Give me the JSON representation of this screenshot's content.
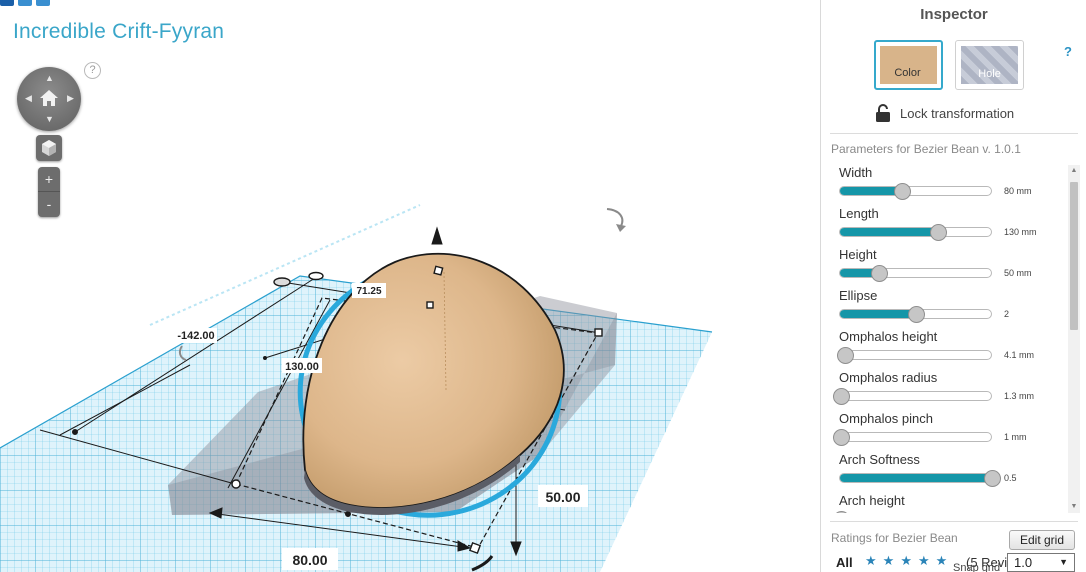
{
  "design_title": "Incredible Crift-Fyyran",
  "view_controls": {
    "help": "?",
    "zoom_in": "+",
    "zoom_out": "-"
  },
  "dimensions": {
    "offset_x": "-142.00",
    "offset_top": "71.25",
    "length": "130.00",
    "height": "50.00",
    "width": "80.00"
  },
  "inspector": {
    "title": "Inspector",
    "color_label": "Color",
    "hole_label": "Hole",
    "help": "?",
    "lock_label": "Lock transformation",
    "params_title": "Parameters for Bezier Bean v. 1.0.1",
    "params": [
      {
        "name": "Width",
        "value": "80 mm",
        "level": 0.41
      },
      {
        "name": "Length",
        "value": "130 mm",
        "level": 0.65
      },
      {
        "name": "Height",
        "value": "50 mm",
        "level": 0.26
      },
      {
        "name": "Ellipse",
        "value": "2",
        "level": 0.5
      },
      {
        "name": "Omphalos height",
        "value": "4.1 mm",
        "level": 0.04
      },
      {
        "name": "Omphalos radius",
        "value": "1.3 mm",
        "level": 0.01
      },
      {
        "name": "Omphalos pinch",
        "value": "1 mm",
        "level": 0.01
      },
      {
        "name": "Arch Softness",
        "value": "0.5",
        "level": 1.0
      },
      {
        "name": "Arch height",
        "value": "",
        "level": 0.01
      }
    ],
    "ratings_title": "Ratings for Bezier Bean",
    "edit_grid": "Edit grid",
    "ratings_all": "All",
    "reviews": "(5 Revi",
    "snap_grid_label": "Snap grid",
    "snap_grid_value": "1.0"
  },
  "colors": {
    "accent": "#3aa6c9",
    "slider_fill": "#1596a8",
    "shape_color": "#d8b48a",
    "grid": "#5bc0e0"
  },
  "icons": [
    "home-icon",
    "cube-view-icon",
    "lock-open-icon",
    "rotate-arrow-icon",
    "star-icon",
    "chevron-down-icon"
  ]
}
